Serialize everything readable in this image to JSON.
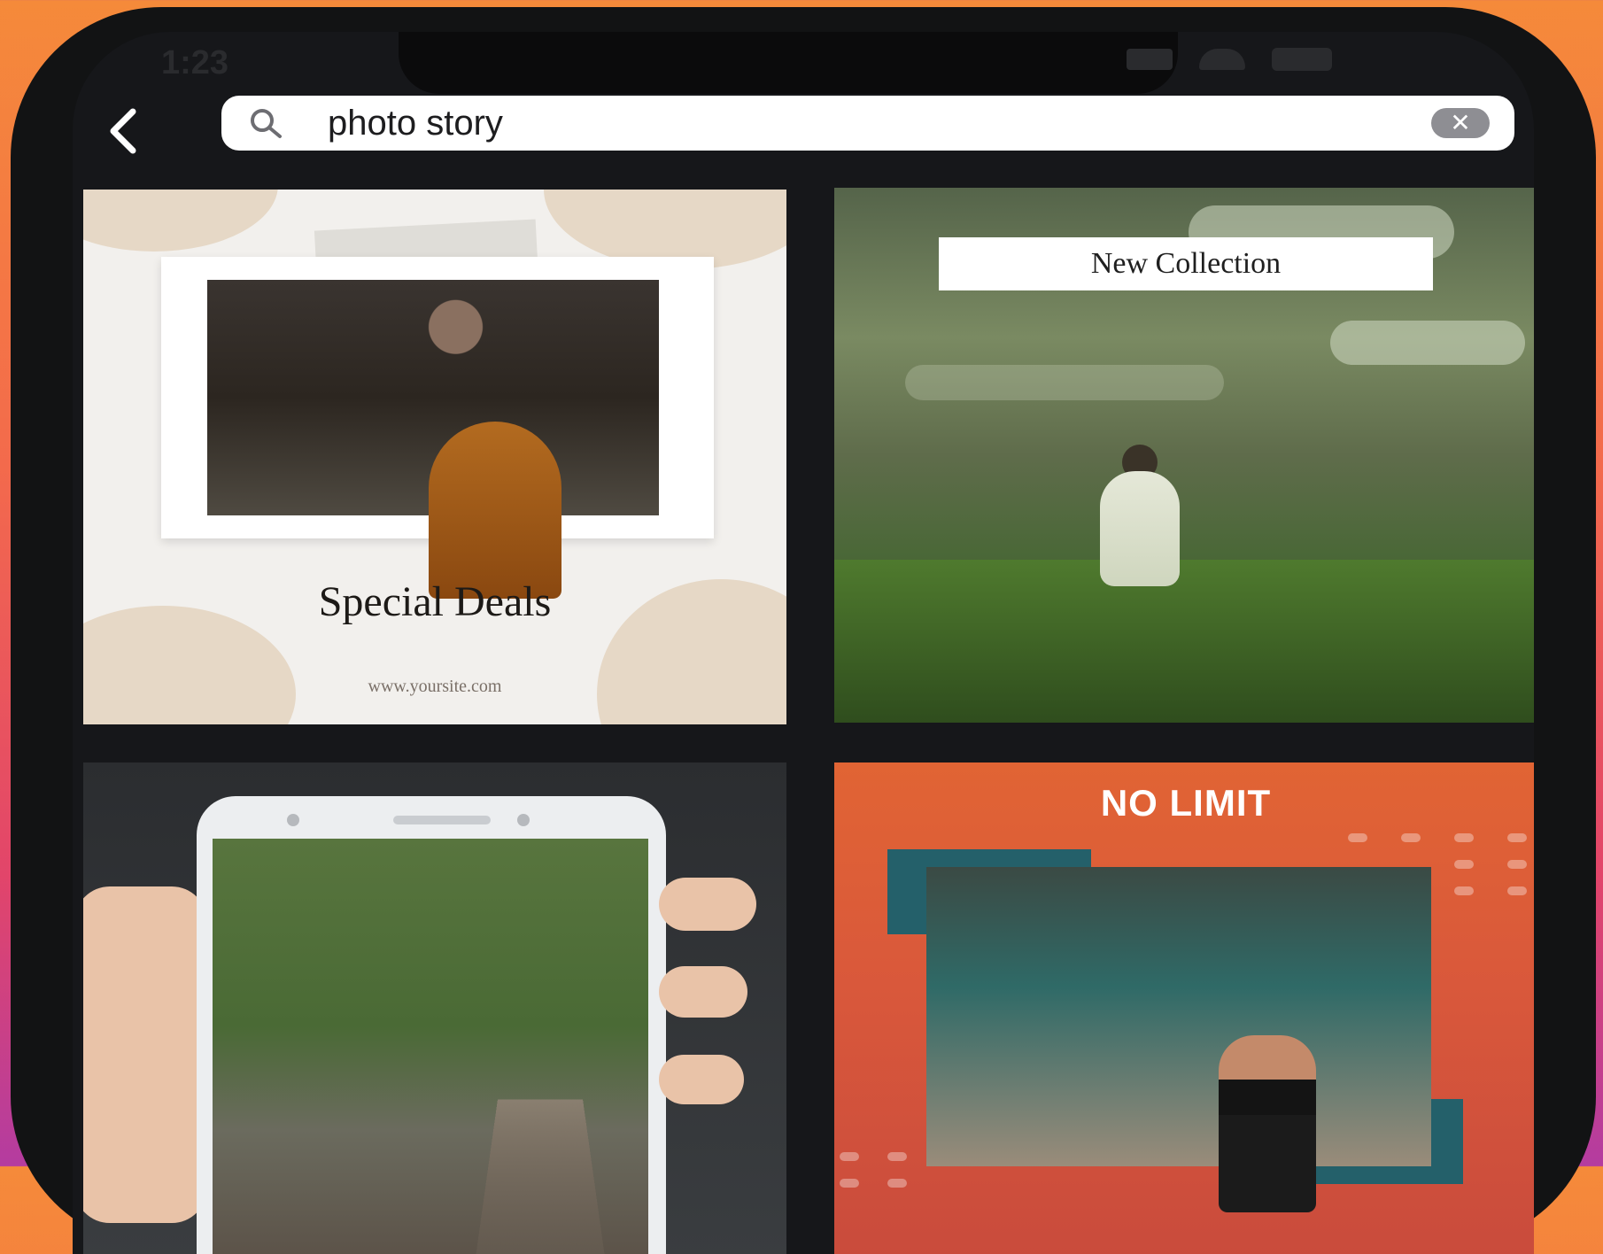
{
  "status_bar": {
    "time": "1:23"
  },
  "search": {
    "value": "photo story",
    "placeholder": ""
  },
  "templates": [
    {
      "title": "Special Deals",
      "subtitle": "www.yoursite.com"
    },
    {
      "title": "New Collection"
    },
    {},
    {
      "title": "NO LIMIT"
    }
  ],
  "icons": {
    "back": "chevron-left-icon",
    "search": "search-icon",
    "clear": "clear-icon"
  },
  "colors": {
    "background_top": "#f58a3a",
    "background_bottom": "#b43ca0",
    "app_background": "#16171a",
    "search_field": "#ffffff",
    "clear_button": "#8e8e93",
    "card4_accent": "#24606a"
  }
}
